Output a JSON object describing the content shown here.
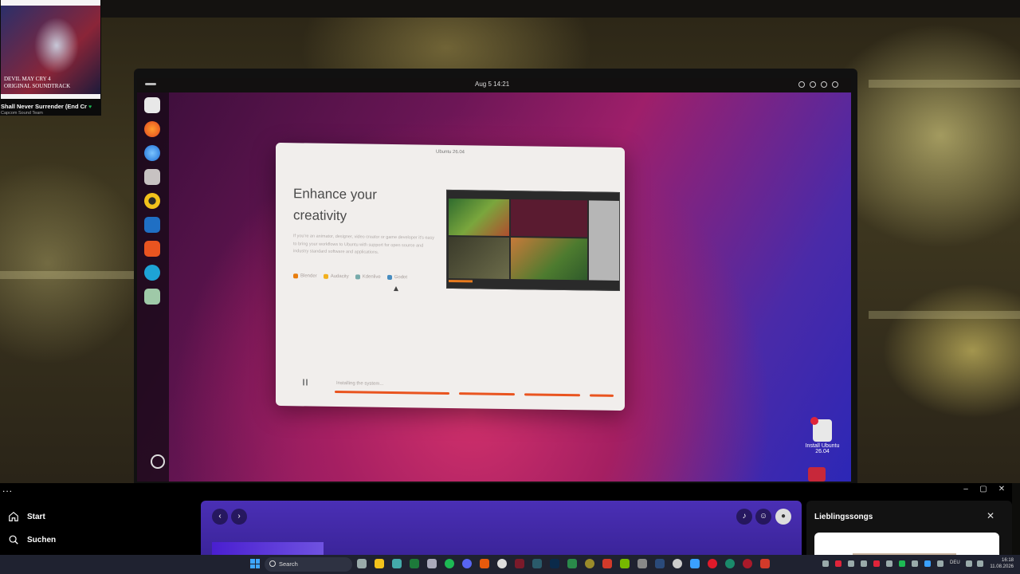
{
  "ubuntu": {
    "clock": "Aug 5  14:21",
    "installer": {
      "window_title": "Ubuntu 26.04",
      "headline_line1": "Enhance your",
      "headline_line2": "creativity",
      "description": "If you're an animator, designer, video creator or game developer it's easy to bring your workflows to Ubuntu with support for open source and industry standard software and applications.",
      "apps": [
        "Blender",
        "Audacity",
        "Kdenlive",
        "Godot"
      ],
      "status": "Installing the system...",
      "progress": 0.9
    },
    "desktop_icon_label": "Install Ubuntu 26.04"
  },
  "pip": {
    "album_line1": "DEVIL MAY CRY 4",
    "album_line2": "ORIGINAL SOUNDTRACK",
    "track": "Shall Never Surrender (End Credits)",
    "artist": "Capcom Sound Team"
  },
  "spotify": {
    "menu": "...",
    "nav": {
      "home": "Start",
      "search": "Suchen"
    },
    "right_panel_title": "Lieblingssongs",
    "back_glyph": "‹",
    "forward_glyph": "›"
  },
  "taskbar": {
    "search_label": "Search",
    "language": "DEU",
    "time": "16:18",
    "date": "11.08.2026"
  },
  "icons": [
    "home-icon",
    "search-icon",
    "bell-icon",
    "friends-icon",
    "avatar",
    "close-icon",
    "windows-start-icon"
  ]
}
